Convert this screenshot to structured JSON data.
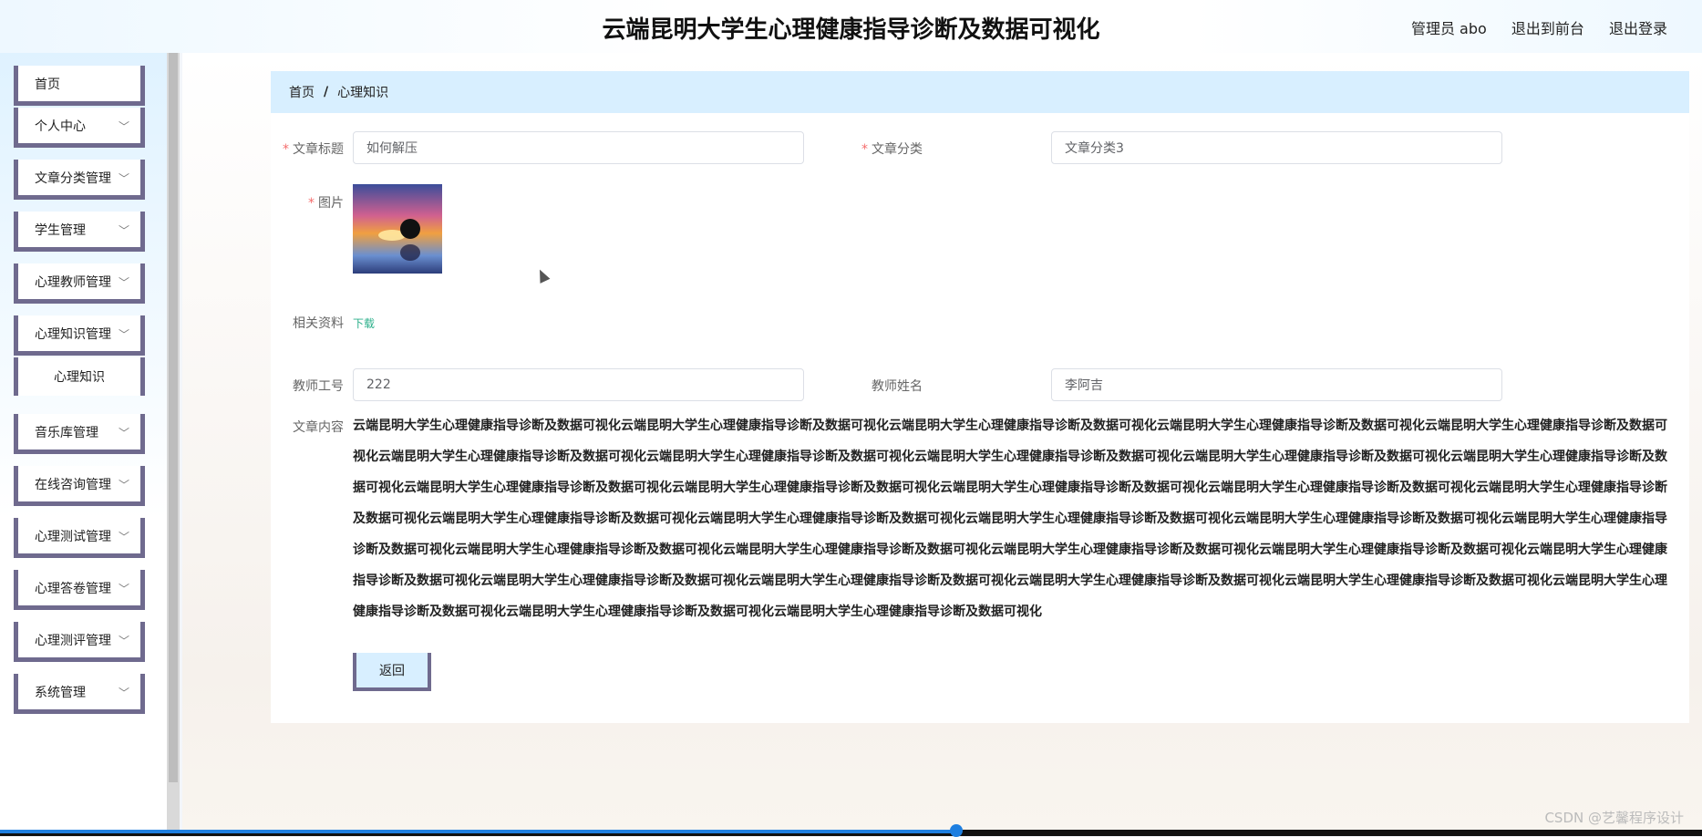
{
  "header": {
    "title": "云端昆明大学生心理健康指导诊断及数据可视化",
    "user_label": "管理员 abo",
    "front_link": "退出到前台",
    "logout_link": "退出登录"
  },
  "sidebar": {
    "items": [
      {
        "label": "首页",
        "has_chevron": false
      },
      {
        "label": "个人中心",
        "has_chevron": true
      },
      {
        "label": "文章分类管理",
        "has_chevron": true
      },
      {
        "label": "学生管理",
        "has_chevron": true
      },
      {
        "label": "心理教师管理",
        "has_chevron": true
      },
      {
        "label": "心理知识管理",
        "has_chevron": true
      },
      {
        "label": "音乐库管理",
        "has_chevron": true
      },
      {
        "label": "在线咨询管理",
        "has_chevron": true
      },
      {
        "label": "心理测试管理",
        "has_chevron": true
      },
      {
        "label": "心理答卷管理",
        "has_chevron": true
      },
      {
        "label": "心理测评管理",
        "has_chevron": true
      },
      {
        "label": "系统管理",
        "has_chevron": true
      }
    ],
    "submenu": {
      "label": "心理知识"
    }
  },
  "breadcrumb": {
    "home": "首页",
    "separator": "/",
    "current": "心理知识"
  },
  "form": {
    "title_label": "文章标题",
    "title_value": "如何解压",
    "category_label": "文章分类",
    "category_value": "文章分类3",
    "image_label": "图片",
    "material_label": "相关资料",
    "download_text": "下载",
    "teacher_id_label": "教师工号",
    "teacher_id_value": "222",
    "teacher_name_label": "教师姓名",
    "teacher_name_value": "李阿吉",
    "content_label": "文章内容",
    "content_text": "云端昆明大学生心理健康指导诊断及数据可视化云端昆明大学生心理健康指导诊断及数据可视化云端昆明大学生心理健康指导诊断及数据可视化云端昆明大学生心理健康指导诊断及数据可视化云端昆明大学生心理健康指导诊断及数据可视化云端昆明大学生心理健康指导诊断及数据可视化云端昆明大学生心理健康指导诊断及数据可视化云端昆明大学生心理健康指导诊断及数据可视化云端昆明大学生心理健康指导诊断及数据可视化云端昆明大学生心理健康指导诊断及数据可视化云端昆明大学生心理健康指导诊断及数据可视化云端昆明大学生心理健康指导诊断及数据可视化云端昆明大学生心理健康指导诊断及数据可视化云端昆明大学生心理健康指导诊断及数据可视化云端昆明大学生心理健康指导诊断及数据可视化云端昆明大学生心理健康指导诊断及数据可视化云端昆明大学生心理健康指导诊断及数据可视化云端昆明大学生心理健康指导诊断及数据可视化云端昆明大学生心理健康指导诊断及数据可视化云端昆明大学生心理健康指导诊断及数据可视化云端昆明大学生心理健康指导诊断及数据可视化云端昆明大学生心理健康指导诊断及数据可视化云端昆明大学生心理健康指导诊断及数据可视化云端昆明大学生心理健康指导诊断及数据可视化云端昆明大学生心理健康指导诊断及数据可视化云端昆明大学生心理健康指导诊断及数据可视化云端昆明大学生心理健康指导诊断及数据可视化云端昆明大学生心理健康指导诊断及数据可视化云端昆明大学生心理健康指导诊断及数据可视化云端昆明大学生心理健康指导诊断及数据可视化云端昆明大学生心理健康指导诊断及数据可视化云端昆明大学生心理健康指导诊断及数据可视化",
    "back_button": "返回"
  },
  "watermark": "CSDN @艺馨程序设计",
  "colors": {
    "accent_border": "#6f6a8e",
    "breadcrumb_bg": "#d8efff",
    "required": "#f56c6c",
    "download_link": "#2baf8a"
  }
}
